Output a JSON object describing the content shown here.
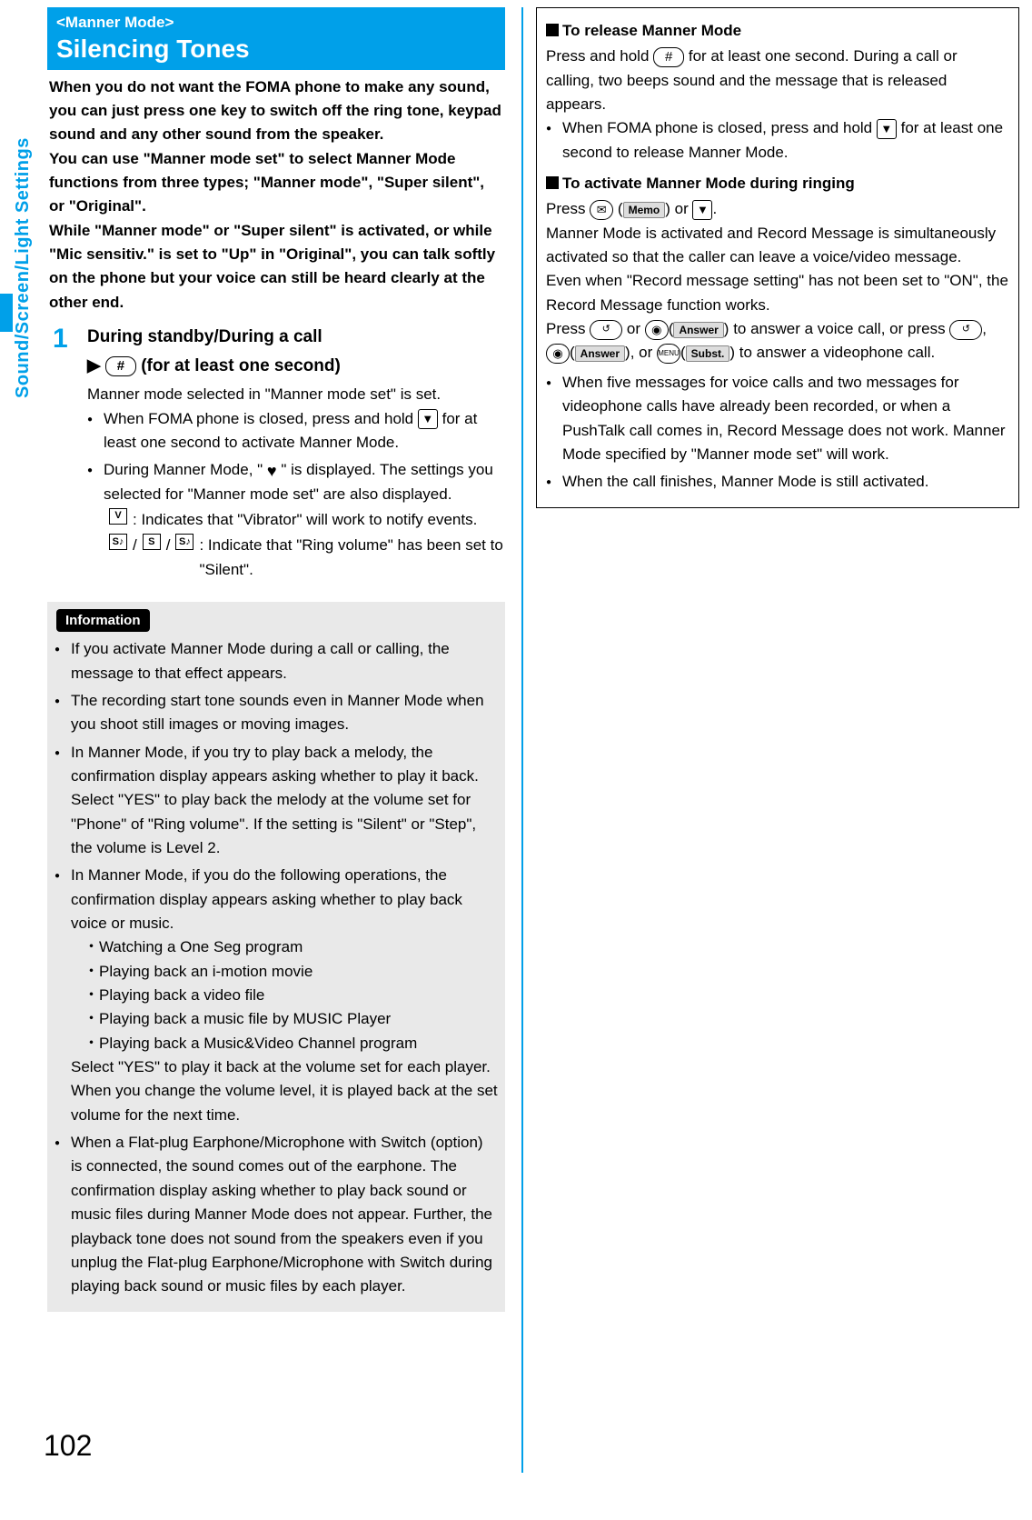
{
  "side_label": "Sound/Screen/Light Settings",
  "page_number": "102",
  "left": {
    "tag": "<Manner Mode>",
    "title": "Silencing Tones",
    "intro": "When you do not want the FOMA phone to make any sound, you can just press one key to switch off the ring tone, keypad sound and any other sound from the speaker.\nYou can use \"Manner mode set\" to select Manner Mode functions from three types; \"Manner mode\", \"Super silent\", or \"Original\".\nWhile \"Manner mode\" or \"Super silent\" is activated, or while \"Mic sensitiv.\" is set to \"Up\" in \"Original\", you can talk softly on the phone but your voice can still be heard clearly at the other end.",
    "step_num": "1",
    "step_line1": "During standby/During a call",
    "step_arrow": "▶",
    "key_hash": "#",
    "step_line2_suffix": "(for at least one second)",
    "step_text": "Manner mode selected in \"Manner mode set\" is set.",
    "step_b1_a": "When FOMA phone is closed, press and hold ",
    "step_b1_b": " for at least one second to activate Manner Mode.",
    "step_b2_a": "During Manner Mode, \"",
    "step_b2_b": "\" is displayed. The settings you selected for \"Manner mode set\" are also displayed.",
    "icon_vib": "V",
    "icon_vib_text": ": Indicates that \"Vibrator\" will work to notify events.",
    "icon_s1": "S♪",
    "icon_s2": "S",
    "icon_s3": "S♪",
    "icon_s_text": ": Indicate that \"Ring volume\" has been set to \"Silent\".",
    "info_label": "Information",
    "info1": "If you activate Manner Mode during a call or calling, the message to that effect appears.",
    "info2": "The recording start tone sounds even in Manner Mode when you shoot still images or moving images.",
    "info3": "In Manner Mode, if you try to play back a melody, the confirmation display appears asking whether to play it back. Select \"YES\" to play back the melody at the volume set for \"Phone\" of \"Ring volume\". If the setting is \"Silent\" or \"Step\", the volume is Level 2.",
    "info4_head": "In Manner Mode, if you do the following operations, the confirmation display appears asking whether to play back voice or music.",
    "info4_items": [
      "・Watching a One Seg program",
      "・Playing back an i-motion movie",
      "・Playing back a video file",
      "・Playing back a music file by MUSIC Player",
      "・Playing back a Music&Video Channel program"
    ],
    "info4_tail": "Select \"YES\" to play it back at the volume set for each player. When you change the volume level, it is played back at the set volume for the next time.",
    "info5": "When a Flat-plug Earphone/Microphone with Switch (option) is connected, the sound comes out of the earphone. The confirmation display asking whether to play back sound or music files during Manner Mode does not appear. Further, the playback tone does not sound from the speakers even if you unplug the Flat-plug Earphone/Microphone with Switch during playing back sound or music files by each player."
  },
  "right": {
    "h1": "To release Manner Mode",
    "r1_a": "Press and hold ",
    "r1_b": " for at least one second. During a call or calling, two beeps sound and the message that is released appears.",
    "r1_bul_a": "When FOMA phone is closed, press and hold ",
    "r1_bul_b": " for at least one second to release Manner Mode.",
    "h2": "To activate Manner Mode during ringing",
    "r2_a": "Press ",
    "chip_memo": "Memo",
    "r2_b": " or ",
    "r2_c": ".",
    "r2_d": "Manner Mode is activated and Record Message is simultaneously activated so that the caller can leave a voice/video message.",
    "r2_e": "Even when \"Record message setting\" has not been set to \"ON\", the Record Message function works.",
    "r3_a": "Press ",
    "r3_b": " or ",
    "chip_answer": "Answer",
    "r3_c": " to answer a voice call, or press ",
    "r3_d": ", ",
    "r3_e": ", or ",
    "key_menu": "MENU",
    "chip_subst": "Subst.",
    "r3_f": " to answer a videophone call.",
    "b1": "When five messages for voice calls and two messages for videophone calls have already been recorded, or when a PushTalk call comes in, Record Message does not work. Manner Mode specified by \"Manner mode set\" will work.",
    "b2": "When the call finishes, Manner Mode is still activated."
  }
}
